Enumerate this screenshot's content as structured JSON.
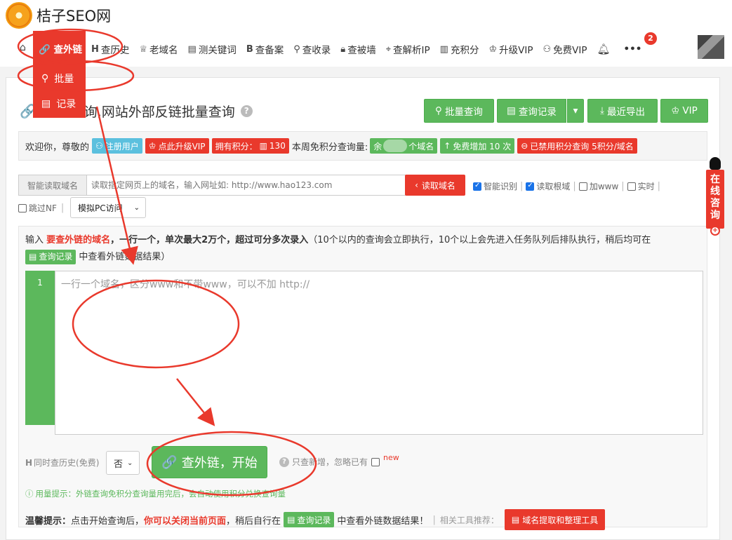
{
  "site": {
    "name": "桔子SEO网"
  },
  "nav": {
    "active": "查外链",
    "items": [
      "查历史",
      "老域名",
      "测关键词",
      "查备案",
      "查收录",
      "查被墙",
      "查解析IP",
      "充积分",
      "升级VIP",
      "免费VIP"
    ],
    "bell_count": "2",
    "more": "•••"
  },
  "dropdown": {
    "batch": "批量",
    "records": "记录"
  },
  "page": {
    "title_visible": "询,网站外部反链批量查询",
    "help": "?"
  },
  "actions": {
    "batch_query": "批量查询",
    "query_records": "查询记录",
    "recent_export": "最近导出",
    "vip": "VIP"
  },
  "welcome": {
    "greeting": "欢迎你，尊敬的",
    "register": "注册用户",
    "upgrade": "点此升级VIP",
    "points": "拥有积分：",
    "points_value": "130",
    "weekly": "本周免积分查询量:",
    "remain_prefix": "余",
    "remain_suffix": "个域名",
    "free_add": "免费增加 10 次",
    "disabled": "已禁用积分查询 5积分/域名"
  },
  "reader": {
    "label": "智能读取域名",
    "placeholder": "读取指定网页上的域名，输入网址如: http://www.hao123.com",
    "button": "读取域名",
    "opt_smart": "智能识别",
    "opt_root": "读取根域",
    "opt_www": "加www",
    "opt_realtime": "实时",
    "opt_skipnf": "跳过NF",
    "sim_select": "模拟PC访问"
  },
  "input": {
    "prefix": "输入",
    "em": "要查外链的域名",
    "middle": "，一行一个，单次最大2万个，超过可分多次录入",
    "paren": "（10个以内的查询会立即执行，10个以上会先进入任务队列后排队执行，稍后均可在",
    "records_tag": "查询记录",
    "tail": "中查看外链数据结果）",
    "line_no": "1",
    "placeholder": "一行一个域名，区分www和不带www，可以不加 http://"
  },
  "controls": {
    "history": "同时查历史(免费)",
    "history_value": "否",
    "start": "查外链，开始",
    "only_new": "只查新增，忽略已有",
    "new_badge": "new"
  },
  "tip": "用量提示：外链查询免积分查询量用完后，会自动使用积分兑换查询量",
  "warm": {
    "label": "温馨提示：",
    "t1": "点击开始查询后，",
    "t2": "你可以关闭当前页面",
    "t3": "，稍后自行在",
    "records": "查询记录",
    "t4": "中查看外链数据结果！",
    "related": "相关工具推荐：",
    "tool": "域名提取和整理工具"
  },
  "side": {
    "consult": "在线咨询"
  },
  "colors": {
    "accent_red": "#e9392c",
    "green": "#5cb85c",
    "blue_tag": "#5bc0de"
  }
}
